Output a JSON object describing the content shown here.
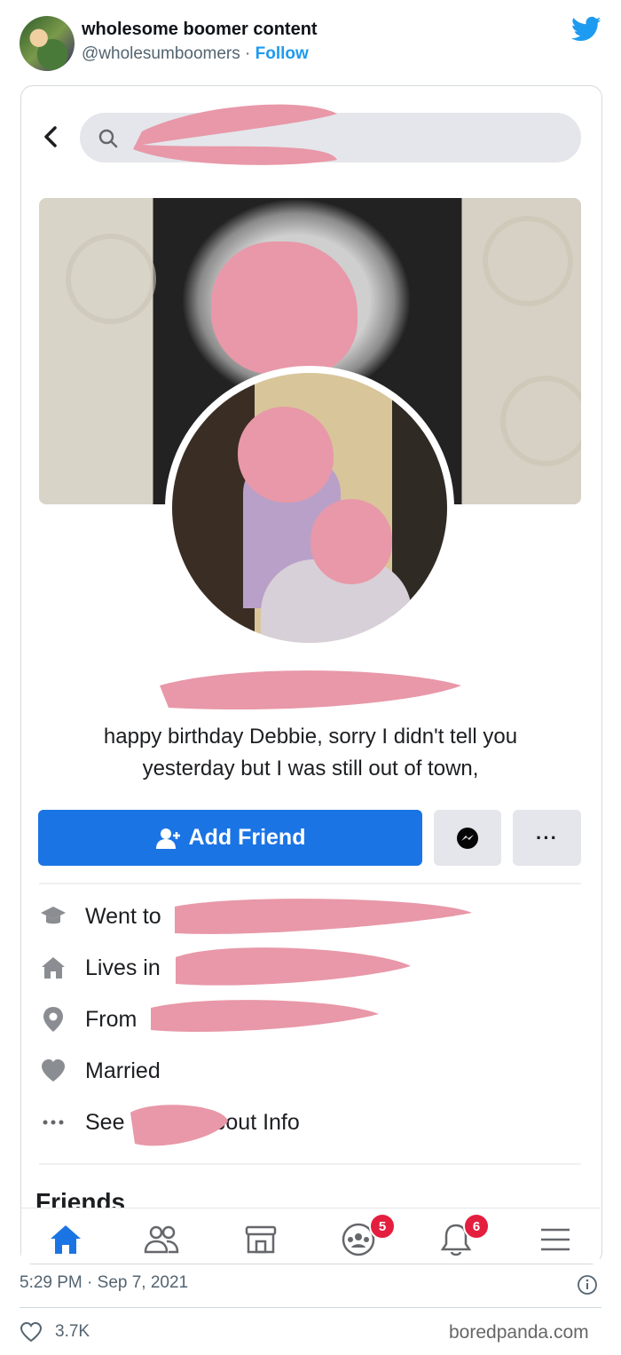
{
  "tweet": {
    "display_name": "wholesome boomer content",
    "handle": "@wholesumboomers",
    "separator": " · ",
    "follow_label": "Follow",
    "timestamp": "5:29 PM · Sep 7, 2021",
    "like_count": "3.7K"
  },
  "profile": {
    "post_text_line1": "happy birthday Debbie, sorry I didn't tell you",
    "post_text_line2": "yesterday but I was still out of town,",
    "add_friend_label": "Add Friend",
    "more_label": "···",
    "info": {
      "went_to": "Went to",
      "lives_in": "Lives in",
      "from": "From",
      "married": "Married",
      "see": "See",
      "about_info": "bout Info"
    },
    "friends_heading": "Friends"
  },
  "tabbar": {
    "groups_badge": "5",
    "notifications_badge": "6"
  },
  "watermark": "boredpanda.com",
  "colors": {
    "twitter_blue": "#1d9bf0",
    "facebook_blue": "#1b74e4",
    "redaction_pink": "#e898a8",
    "badge_red": "#e41e3f"
  }
}
